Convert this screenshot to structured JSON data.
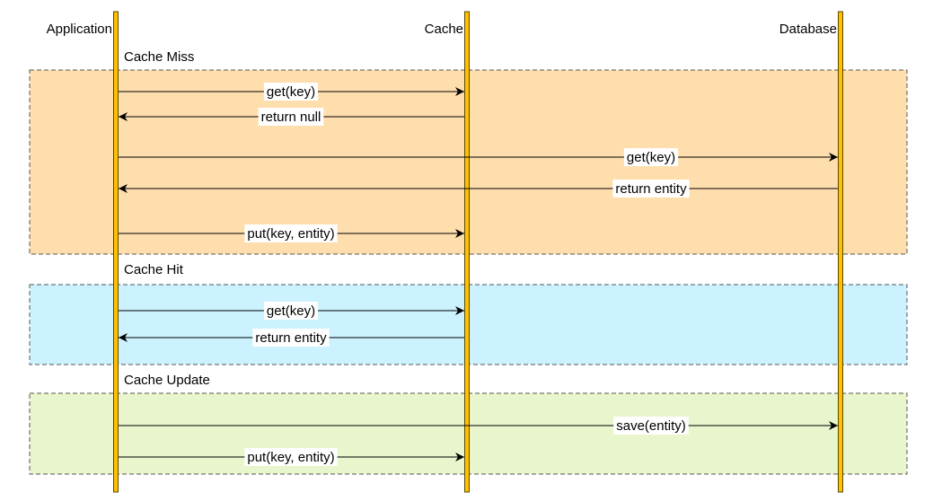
{
  "participants": [
    {
      "name": "Application"
    },
    {
      "name": "Cache"
    },
    {
      "name": "Database"
    }
  ],
  "colors": {
    "lifeline": "#FFC000",
    "lifeline_border": "#5a4a00",
    "cache_miss": "#FFDEAD",
    "cache_hit": "#CCF2FF",
    "cache_update": "#E9F5CC",
    "frame_border": "#555555"
  },
  "groups": [
    {
      "title": "Cache Miss",
      "color_key": "cache_miss",
      "messages": [
        {
          "from": "Application",
          "to": "Cache",
          "label": "get(key)"
        },
        {
          "from": "Cache",
          "to": "Application",
          "label": "return null"
        },
        {
          "from": "Application",
          "to": "Database",
          "label": "get(key)"
        },
        {
          "from": "Database",
          "to": "Application",
          "label": "return entity"
        },
        {
          "from": "Application",
          "to": "Cache",
          "label": "put(key, entity)"
        }
      ]
    },
    {
      "title": "Cache Hit",
      "color_key": "cache_hit",
      "messages": [
        {
          "from": "Application",
          "to": "Cache",
          "label": "get(key)"
        },
        {
          "from": "Cache",
          "to": "Application",
          "label": "return entity"
        }
      ]
    },
    {
      "title": "Cache Update",
      "color_key": "cache_update",
      "messages": [
        {
          "from": "Application",
          "to": "Database",
          "label": "save(entity)"
        },
        {
          "from": "Application",
          "to": "Cache",
          "label": "put(key, entity)"
        }
      ]
    }
  ]
}
